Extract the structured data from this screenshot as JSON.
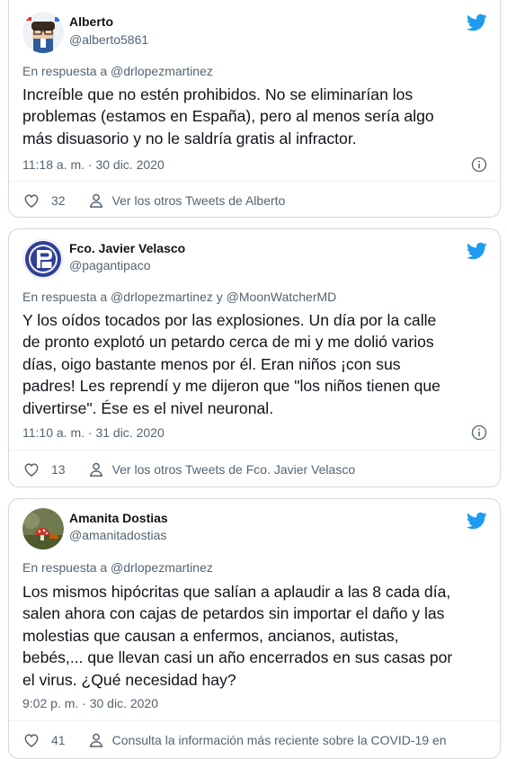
{
  "tweets": [
    {
      "name": "Alberto",
      "handle": "@alberto5861",
      "reply_to": "En respuesta a @drlopezmartinez",
      "text_lines": [
        "Increíble que no estén prohibidos. No se eliminarían los",
        "problemas (estamos en España), pero al menos sería algo",
        "más disuasorio y no le saldría gratis al infractor."
      ],
      "timestamp": "11:18 a. m. · 30 dic. 2020",
      "likes": "32",
      "link": "Ver los otros Tweets de Alberto"
    },
    {
      "name": "Fco. Javier Velasco",
      "handle": "@pagantipaco",
      "reply_to": "En respuesta a @drlopezmartinez y @MoonWatcherMD",
      "text_lines": [
        "Y los oídos tocados por las explosiones. Un día por la calle",
        "de pronto explotó un petardo cerca de mi y me dolió varios",
        "días, oigo bastante menos por él. Eran niños ¡con sus",
        "padres! Les reprendí y me dijeron que \"los niños tienen que",
        "divertirse\". Ése es el nivel neuronal."
      ],
      "timestamp": "11:10 a. m. · 31 dic. 2020",
      "likes": "13",
      "link": "Ver los otros Tweets de Fco. Javier Velasco"
    },
    {
      "name": "Amanita Dostias",
      "handle": "@amanitadostias",
      "reply_to": "En respuesta a @drlopezmartinez",
      "text_lines": [
        "Los mismos hipócritas que salían a aplaudir a las 8 cada día,",
        "salen ahora con cajas de petardos sin importar el daño y las",
        "molestias que causan a enfermos, ancianos, autistas,",
        "bebés,... que llevan casi un año encerrados en sus casas por",
        "el virus. ¿Qué necesidad hay?"
      ],
      "timestamp": "9:02 p. m. · 30 dic. 2020",
      "likes": "41",
      "link": "Consulta la información más reciente sobre la COVID-19 en"
    }
  ],
  "colors": {
    "twitter_blue": "#1d9bf0",
    "secondary_text": "#536471",
    "border": "#cfd9de"
  },
  "icons": {
    "brand": "twitter-bird-icon",
    "like": "heart-icon",
    "profile": "person-icon",
    "info": "info-icon"
  }
}
